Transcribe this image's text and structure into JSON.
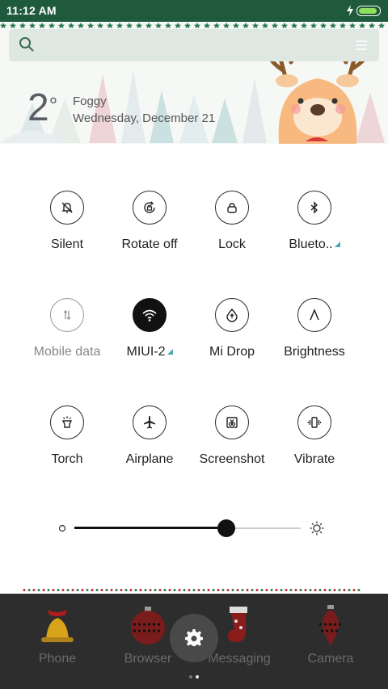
{
  "status_bar": {
    "time": "11:12 AM",
    "battery_level": 1.0
  },
  "weather": {
    "temperature": "2",
    "degree_symbol": "°",
    "condition": "Foggy",
    "date": "Wednesday, December 21"
  },
  "quick_settings": [
    {
      "label": "Silent",
      "icon": "bell-off-icon",
      "state": "off"
    },
    {
      "label": "Rotate off",
      "icon": "rotate-lock-icon",
      "state": "off"
    },
    {
      "label": "Lock",
      "icon": "lock-icon",
      "state": "off"
    },
    {
      "label": "Blueto..",
      "icon": "bluetooth-icon",
      "state": "off"
    },
    {
      "label": "Mobile data",
      "icon": "mobile-data-icon",
      "state": "disabled"
    },
    {
      "label": "MIUI-2",
      "icon": "wifi-icon",
      "state": "on"
    },
    {
      "label": "Mi Drop",
      "icon": "mi-drop-icon",
      "state": "off"
    },
    {
      "label": "Brightness",
      "icon": "brightness-auto-icon",
      "state": "off"
    },
    {
      "label": "Torch",
      "icon": "torch-icon",
      "state": "off"
    },
    {
      "label": "Airplane",
      "icon": "airplane-icon",
      "state": "off"
    },
    {
      "label": "Screenshot",
      "icon": "screenshot-icon",
      "state": "off"
    },
    {
      "label": "Vibrate",
      "icon": "vibrate-icon",
      "state": "off"
    }
  ],
  "brightness_slider": {
    "value": 0.67
  },
  "dock": {
    "apps": [
      {
        "label": "Phone",
        "icon": "phone-bell-icon"
      },
      {
        "label": "Browser",
        "icon": "browser-ornament-icon"
      },
      {
        "label": "Messaging",
        "icon": "messaging-stocking-icon"
      },
      {
        "label": "Camera",
        "icon": "camera-ornament-icon"
      }
    ]
  },
  "colors": {
    "status_bar": "#1f5a3c",
    "accent_triangle": "#4aa5b5",
    "dock": "#2d2d2d"
  }
}
